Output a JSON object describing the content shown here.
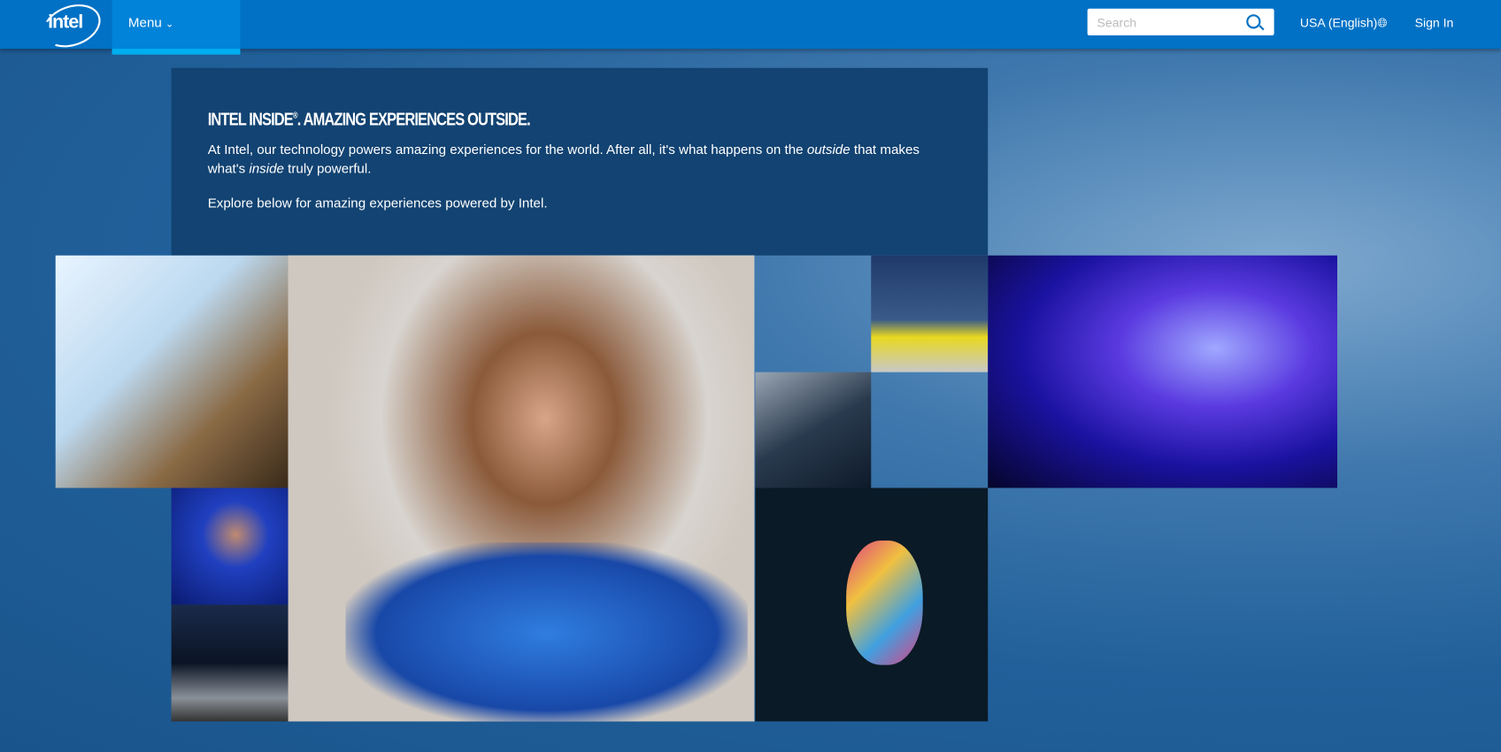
{
  "header": {
    "logo": "intel",
    "menu_label": "Menu",
    "menu_icon": "chevron-down-icon",
    "search_placeholder": "Search",
    "search_icon": "search-icon",
    "locale": "USA (English)",
    "globe_icon": "globe-icon",
    "sign_in": "Sign In"
  },
  "hero": {
    "title": "INTEL INSIDE",
    "title_mark": "®",
    "title_rest": ". AMAZING EXPERIENCES OUTSIDE.",
    "para1_a": "At Intel, our technology powers amazing experiences for the world. After all, it's what happens on the ",
    "para1_em1": "outside",
    "para1_b": " that makes what's ",
    "para1_em2": "inside",
    "para1_c": " truly powerful.",
    "para2": "Explore below for amazing experiences powered by Intel."
  },
  "colors": {
    "header": "#0071c5",
    "menu_active": "#00aeef",
    "panel": "#124372"
  }
}
